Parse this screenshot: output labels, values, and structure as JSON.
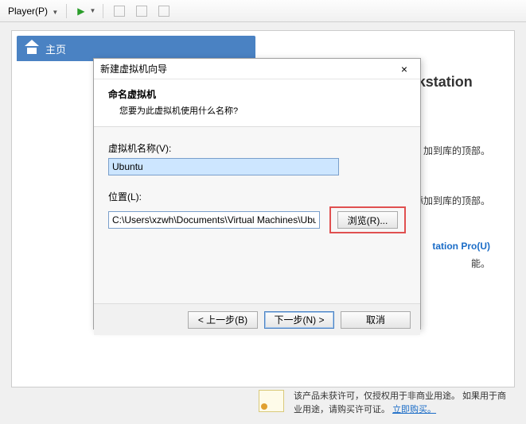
{
  "toolbar": {
    "player_menu": "Player(P)"
  },
  "tabs": {
    "home": "主页"
  },
  "welcome": {
    "title": "欢迎使用 VMware Workstation"
  },
  "side": {
    "text1": "加到库的顶部。",
    "text2": "添加到库的顶部。",
    "upgrade": "tation Pro(U)",
    "text3": "能。"
  },
  "dialog": {
    "window_title": "新建虚拟机向导",
    "heading": "命名虚拟机",
    "subheading": "您要为此虚拟机使用什么名称?",
    "name_label": "虚拟机名称(V):",
    "name_value": "Ubuntu",
    "location_label": "位置(L):",
    "location_value": "C:\\Users\\xzwh\\Documents\\Virtual Machines\\Ubuntu",
    "browse_btn": "浏览(R)...",
    "back_btn": "< 上一步(B)",
    "next_btn": "下一步(N) >",
    "cancel_btn": "取消"
  },
  "footer": {
    "license_text": "该产品未获许可，仅授权用于非商业用途。 如果用于商业用途，请购买许可证。 ",
    "buy_link": "立即购买。"
  }
}
